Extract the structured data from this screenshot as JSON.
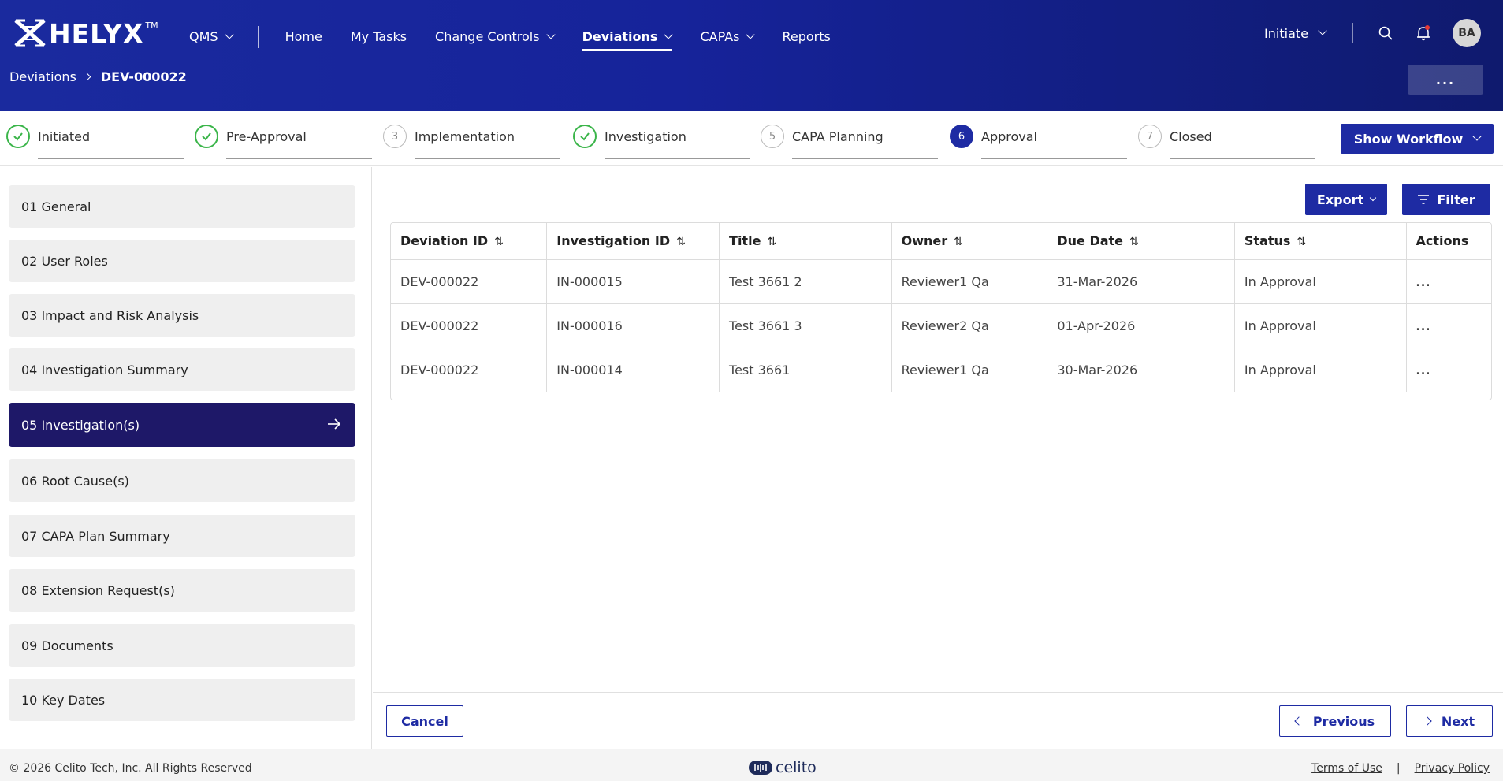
{
  "header": {
    "logo_text": "HELYX",
    "logo_tm": "TM",
    "nav": [
      {
        "label": "QMS",
        "dropdown": true
      },
      {
        "label": "Home",
        "dropdown": false
      },
      {
        "label": "My Tasks",
        "dropdown": false
      },
      {
        "label": "Change Controls",
        "dropdown": true
      },
      {
        "label": "Deviations",
        "dropdown": true,
        "active": true
      },
      {
        "label": "CAPAs",
        "dropdown": true
      },
      {
        "label": "Reports",
        "dropdown": false
      }
    ],
    "initiate_label": "Initiate",
    "avatar_initials": "BA",
    "icons": [
      "search-icon",
      "bell-icon"
    ],
    "notification_dot_color": "#e53935",
    "more_label": "...",
    "colors": {
      "primary": "#1e2ba3",
      "header_dark": "#0f1a6e"
    }
  },
  "breadcrumb": {
    "root": "Deviations",
    "current": "DEV-000022"
  },
  "stepper": {
    "steps": [
      {
        "number": "1",
        "label": "Initiated",
        "state": "done"
      },
      {
        "number": "2",
        "label": "Pre-Approval",
        "state": "done"
      },
      {
        "number": "3",
        "label": "Implementation",
        "state": "pending"
      },
      {
        "number": "4",
        "label": "Investigation",
        "state": "done"
      },
      {
        "number": "5",
        "label": "CAPA Planning",
        "state": "pending"
      },
      {
        "number": "6",
        "label": "Approval",
        "state": "current"
      },
      {
        "number": "7",
        "label": "Closed",
        "state": "pending"
      }
    ],
    "show_workflow_label": "Show Workflow"
  },
  "sidebar": {
    "items": [
      {
        "label": "01 General"
      },
      {
        "label": "02 User Roles"
      },
      {
        "label": "03 Impact and Risk Analysis"
      },
      {
        "label": "04 Investigation Summary"
      },
      {
        "label": "05 Investigation(s)",
        "active": true
      },
      {
        "label": "06 Root Cause(s)"
      },
      {
        "label": "07 CAPA Plan Summary"
      },
      {
        "label": "08 Extension Request(s)"
      },
      {
        "label": "09 Documents"
      },
      {
        "label": "10 Key Dates"
      }
    ]
  },
  "toolbar": {
    "export_label": "Export",
    "filter_label": "Filter"
  },
  "table": {
    "columns": [
      "Deviation ID",
      "Investigation ID",
      "Title",
      "Owner",
      "Due Date",
      "Status",
      "Actions"
    ],
    "sortable": [
      true,
      true,
      true,
      true,
      true,
      true,
      false
    ],
    "rows": [
      {
        "deviation_id": "DEV-000022",
        "investigation_id": "IN-000015",
        "title": "Test 3661 2",
        "owner": "Reviewer1 Qa",
        "due_date": "31-Mar-2026",
        "status": "In Approval",
        "actions": "..."
      },
      {
        "deviation_id": "DEV-000022",
        "investigation_id": "IN-000016",
        "title": "Test 3661 3",
        "owner": "Reviewer2 Qa",
        "due_date": "01-Apr-2026",
        "status": "In Approval",
        "actions": "..."
      },
      {
        "deviation_id": "DEV-000022",
        "investigation_id": "IN-000014",
        "title": "Test 3661",
        "owner": "Reviewer1 Qa",
        "due_date": "30-Mar-2026",
        "status": "In Approval",
        "actions": "..."
      }
    ]
  },
  "actions": {
    "cancel_label": "Cancel",
    "previous_label": "Previous",
    "next_label": "Next"
  },
  "footer": {
    "copyright": "© 2026 Celito Tech, Inc. All Rights Reserved",
    "brand": "celito",
    "terms_label": "Terms of Use",
    "separator": "|",
    "privacy_label": "Privacy Policy"
  }
}
